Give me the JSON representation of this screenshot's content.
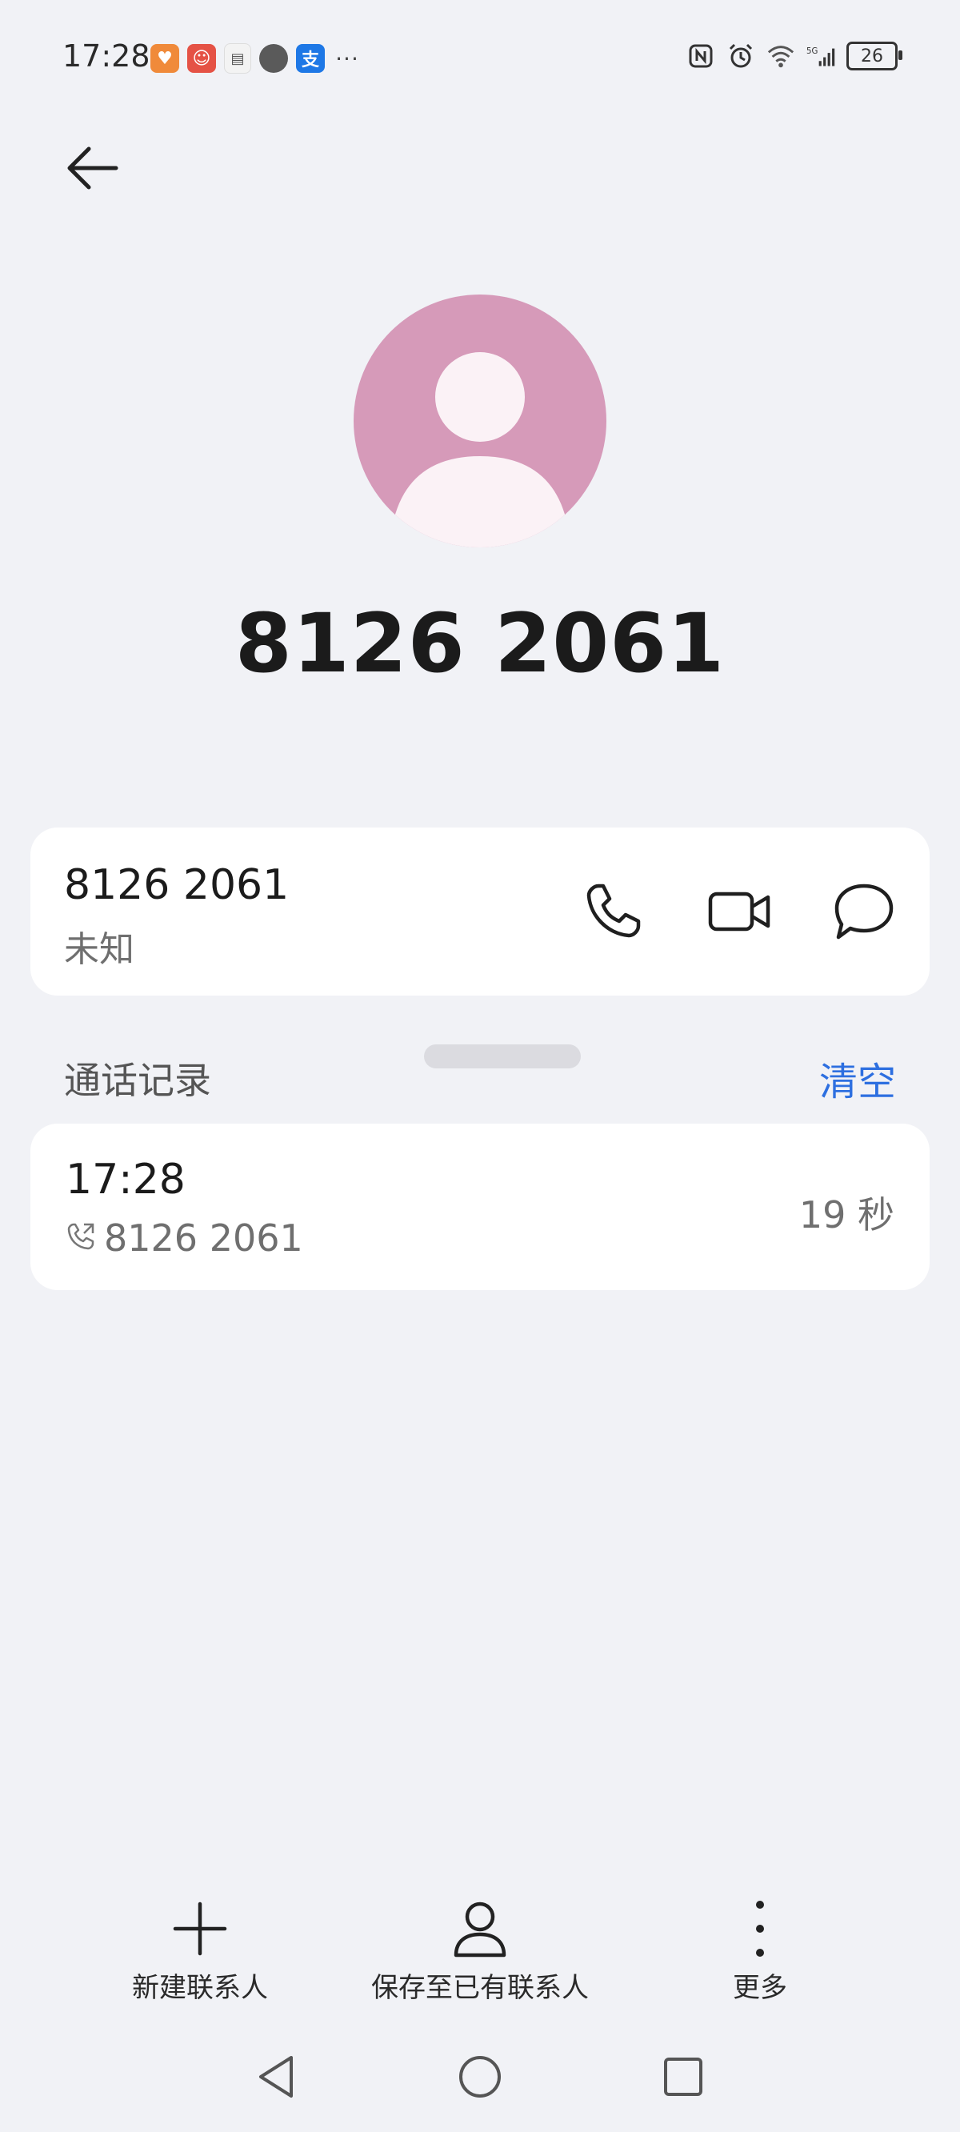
{
  "status_bar": {
    "time": "17:28",
    "notification_icons": [
      "app-icon",
      "app-icon",
      "app-icon",
      "message-icon",
      "alipay-icon",
      "more-notifications-icon"
    ],
    "battery": "26"
  },
  "contact": {
    "title": "8126 2061"
  },
  "number_card": {
    "number": "8126 2061",
    "label": "未知"
  },
  "call_log": {
    "header": "通话记录",
    "clear_label": "清空",
    "entries": [
      {
        "time": "17:28",
        "number": "8126 2061",
        "duration": "19 秒"
      }
    ]
  },
  "bottom_actions": {
    "new_contact": "新建联系人",
    "save_existing": "保存至已有联系人",
    "more": "更多"
  },
  "colors": {
    "background": "#f1f2f6",
    "avatar": "#d69ab9",
    "accent": "#2d6fe0",
    "card": "#ffffff"
  }
}
